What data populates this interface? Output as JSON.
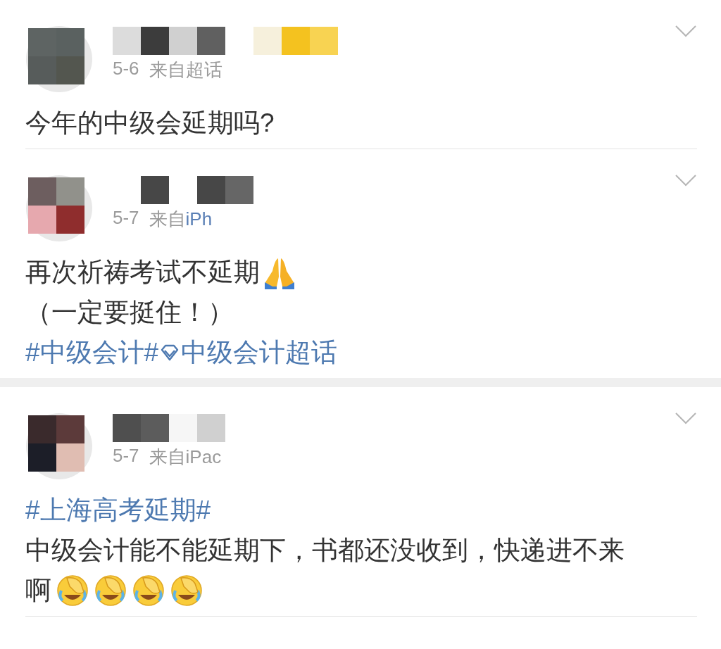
{
  "posts": [
    {
      "date": "5-6",
      "via": "来自",
      "source": "超话",
      "source_link": false,
      "lines": [
        [
          {
            "kind": "text",
            "text": "今年的中级会延期吗?"
          }
        ]
      ],
      "section_end": false
    },
    {
      "date": "5-7",
      "via": "来自",
      "source": "iPh",
      "source_link": true,
      "lines": [
        [
          {
            "kind": "text",
            "text": "再次祈祷考试不延期"
          },
          {
            "kind": "pray"
          }
        ],
        [
          {
            "kind": "text",
            "text": "（一定要挺住！）"
          }
        ],
        [
          {
            "kind": "topic",
            "text": "#中级会计#"
          },
          {
            "kind": "supertopic",
            "text": "中级会计超话"
          }
        ]
      ],
      "section_end": true
    },
    {
      "date": "5-7",
      "via": "来自",
      "source": "iPac",
      "source_link": false,
      "lines": [
        [
          {
            "kind": "topic",
            "text": "#上海高考延期#"
          }
        ],
        [
          {
            "kind": "text",
            "text": "中级会计能不能延期下，书都还没收到，快递进不来"
          }
        ],
        [
          {
            "kind": "text",
            "text": "啊"
          },
          {
            "kind": "facepalm"
          },
          {
            "kind": "facepalm"
          },
          {
            "kind": "facepalm"
          },
          {
            "kind": "facepalm"
          }
        ]
      ],
      "section_end": false
    }
  ]
}
